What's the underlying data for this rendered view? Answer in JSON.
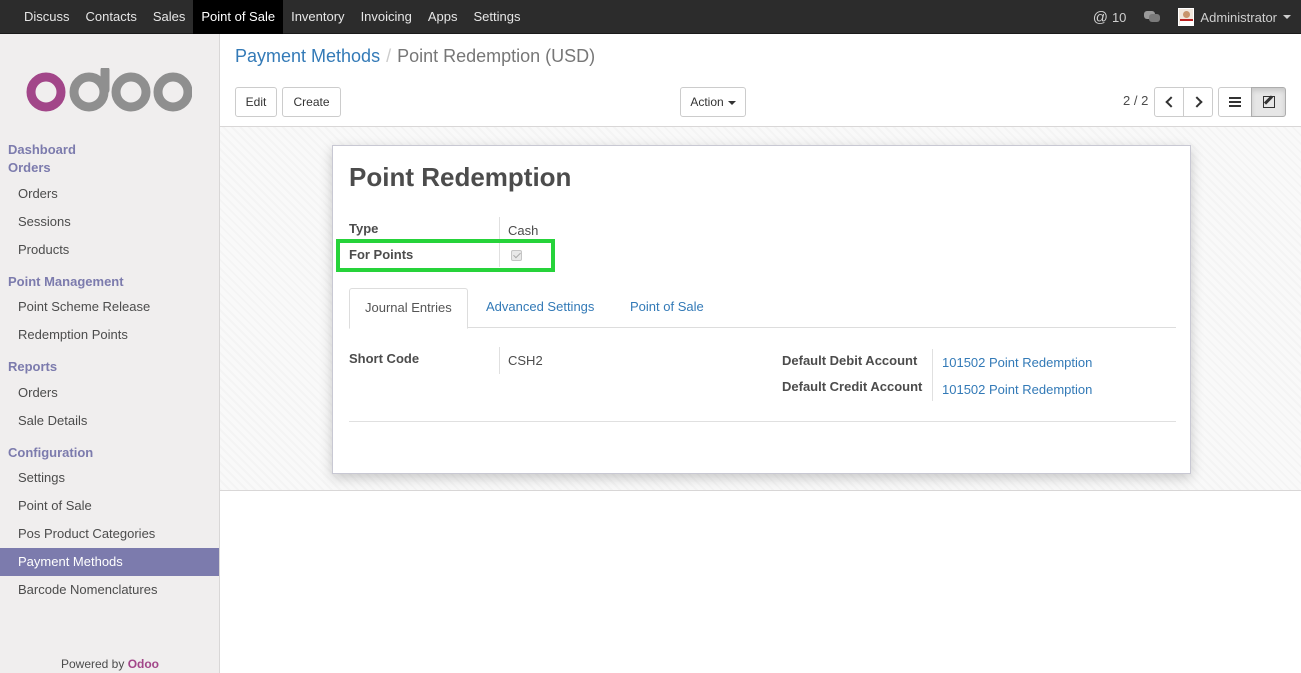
{
  "topbar": {
    "menu": [
      "Discuss",
      "Contacts",
      "Sales",
      "Point of Sale",
      "Inventory",
      "Invoicing",
      "Apps",
      "Settings"
    ],
    "active_menu": "Point of Sale",
    "notifications_count": "10",
    "user": "Administrator"
  },
  "sidebar": {
    "sections": {
      "dashboard": "Dashboard",
      "orders": "Orders",
      "point_management": "Point Management",
      "reports": "Reports",
      "configuration": "Configuration"
    },
    "items": {
      "orders": "Orders",
      "sessions": "Sessions",
      "products": "Products",
      "point_scheme_release": "Point Scheme Release",
      "redemption_points": "Redemption Points",
      "report_orders": "Orders",
      "sale_details": "Sale Details",
      "settings": "Settings",
      "point_of_sale": "Point of Sale",
      "pos_product_categories": "Pos Product Categories",
      "payment_methods": "Payment Methods",
      "barcode_nomenclatures": "Barcode Nomenclatures"
    },
    "powered_by": "Powered by",
    "powered_brand": "Odoo"
  },
  "control": {
    "breadcrumb_parent": "Payment Methods",
    "breadcrumb_current": "Point Redemption (USD)",
    "edit_label": "Edit",
    "create_label": "Create",
    "action_label": "Action",
    "pager": "2 / 2"
  },
  "form": {
    "title": "Point Redemption",
    "type_label": "Type",
    "type_value": "Cash",
    "for_points_label": "For Points",
    "for_points_checked": true,
    "tabs": [
      "Journal Entries",
      "Advanced Settings",
      "Point of Sale"
    ],
    "active_tab": "Journal Entries",
    "short_code_label": "Short Code",
    "short_code_value": "CSH2",
    "debit_label": "Default Debit Account",
    "debit_value": "101502 Point Redemption",
    "credit_label": "Default Credit Account",
    "credit_value": "101502 Point Redemption"
  },
  "colors": {
    "brand": "#7c7bad",
    "link": "#337ab7",
    "highlight": "#26d33a",
    "topbar": "#2c2c2c"
  }
}
